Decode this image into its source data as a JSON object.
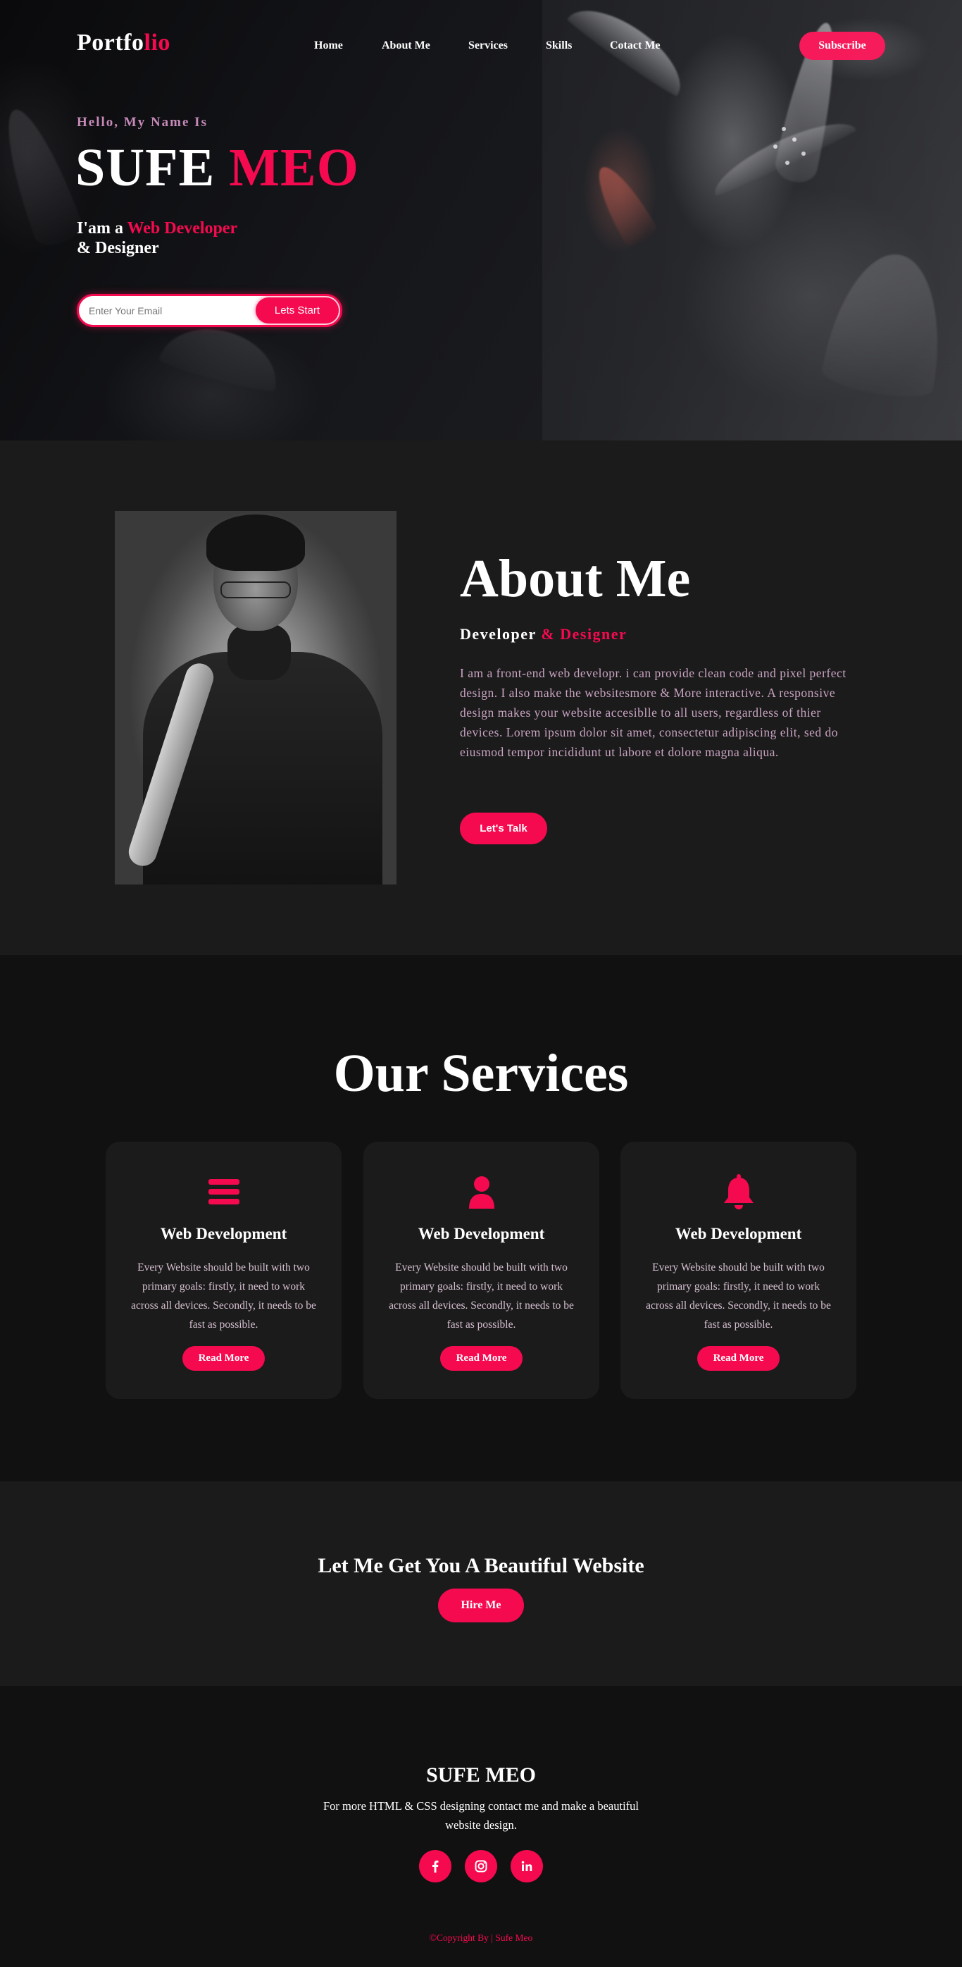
{
  "nav": {
    "logo_main": "Portfo",
    "logo_accent": "lio",
    "items": [
      {
        "label": "Home"
      },
      {
        "label": "About Me"
      },
      {
        "label": "Services"
      },
      {
        "label": "Skills"
      },
      {
        "label": "Cotact Me"
      }
    ],
    "subscribe_label": "Subscribe"
  },
  "hero": {
    "greeting": "Hello, My Name Is",
    "name_first": "SUFE",
    "name_accent": "MEO",
    "role_prefix": "I'am a",
    "role_accent": "Web Developer",
    "role_suffix": "& Designer",
    "email_placeholder": "Enter Your Email",
    "start_label": "Lets Start"
  },
  "about": {
    "title": "About Me",
    "subtitle_main": "Developer",
    "subtitle_accent": "& Designer",
    "text": "I am a front-end web developr. i can provide clean code and pixel perfect design. I also make the websitesmore & More interactive. A responsive design makes your website accesiblle to all users, regardless of thier devices. Lorem ipsum dolor sit amet, consectetur adipiscing elit, sed do eiusmod tempor incididunt ut labore et dolore magna aliqua.",
    "button_label": "Let's Talk"
  },
  "services": {
    "title": "Our Services",
    "cards": [
      {
        "icon": "menu-bars-icon",
        "title": "Web Development",
        "text": "Every Website should be built with two primary goals: firstly, it need to work across all devices. Secondly, it needs to be fast as possible.",
        "button_label": "Read More"
      },
      {
        "icon": "user-icon",
        "title": "Web Development",
        "text": "Every Website should be built with two primary goals: firstly, it need to work across all devices. Secondly, it needs to be fast as possible.",
        "button_label": "Read More"
      },
      {
        "icon": "bell-icon",
        "title": "Web Development",
        "text": "Every Website should be built with two primary goals: firstly, it need to work across all devices. Secondly, it needs to be fast as possible.",
        "button_label": "Read More"
      }
    ]
  },
  "cta": {
    "title": "Let Me Get You A Beautiful Website",
    "button_label": "Hire Me"
  },
  "footer": {
    "name": "SUFE MEO",
    "text": "For more HTML & CSS designing contact me and make a beautiful website design.",
    "social": [
      {
        "icon": "facebook-icon"
      },
      {
        "icon": "instagram-icon"
      },
      {
        "icon": "linkedin-icon"
      }
    ],
    "copyright": "©Copyright By | Sufe Meo"
  },
  "colors": {
    "accent": "#f50a4f",
    "background": "#111111",
    "section_alt": "#1b1b1b",
    "muted_pink": "#c9a3c2"
  }
}
